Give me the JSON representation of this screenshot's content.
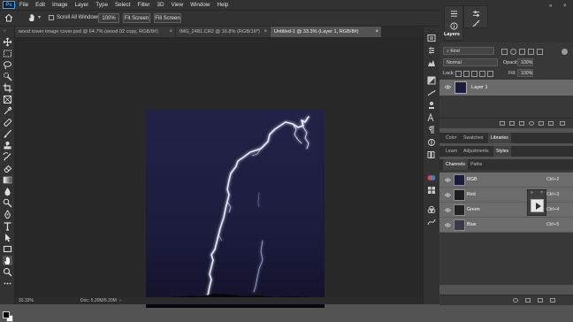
{
  "app": {
    "logo_text": "Ps"
  },
  "menu": [
    "File",
    "Edit",
    "Image",
    "Layer",
    "Type",
    "Select",
    "Filter",
    "3D",
    "View",
    "Window",
    "Help"
  ],
  "window_controls": {
    "minimize": "—",
    "maximize": "❐",
    "close": "✕"
  },
  "options_bar": {
    "scroll_all_windows": "Scroll All Windows",
    "zoom_100": "100%",
    "fit_screen": "Fit Screen",
    "fill_screen": "Fill Screen"
  },
  "doc_tabs": [
    {
      "label": "wood tower image cover.psd @ 64.7% (wood 02 copy, RGB/8#)"
    },
    {
      "label": "IMG_2481.CR2 @ 16.8% (RGB/16*)"
    },
    {
      "label": "Untitled-1 @ 33.3% (Layer 1, RGB/8#)"
    }
  ],
  "tab_close": "×",
  "status": {
    "zoom": "33.33%",
    "doc": "Doc: 5.20M/5.20M",
    "arrow": "›"
  },
  "layers_panel": {
    "tab": "Layers",
    "kind_label": "Kind",
    "blend_mode": "Normal",
    "opacity_label": "Opacity:",
    "opacity_value": "100%",
    "lock_label": "Lock:",
    "fill_label": "Fill:",
    "fill_value": "100%",
    "layer_name": "Layer 1"
  },
  "color_tabs": [
    "Color",
    "Swatches",
    "Libraries"
  ],
  "learn_tabs": [
    "Learn",
    "Adjustments",
    "Styles"
  ],
  "channel_tabs": [
    "Channels",
    "Paths"
  ],
  "channels": [
    {
      "name": "RGB",
      "shortcut": "Ctrl+2"
    },
    {
      "name": "Red",
      "shortcut": "Ctrl+3"
    },
    {
      "name": "Green",
      "shortcut": "Ctrl+4"
    },
    {
      "name": "Blue",
      "shortcut": "Ctrl+5"
    }
  ],
  "colors": {
    "foreground": "#000000",
    "background": "#ffffff",
    "lightning": "#e8ecff",
    "sky": "#1b1b3b"
  }
}
